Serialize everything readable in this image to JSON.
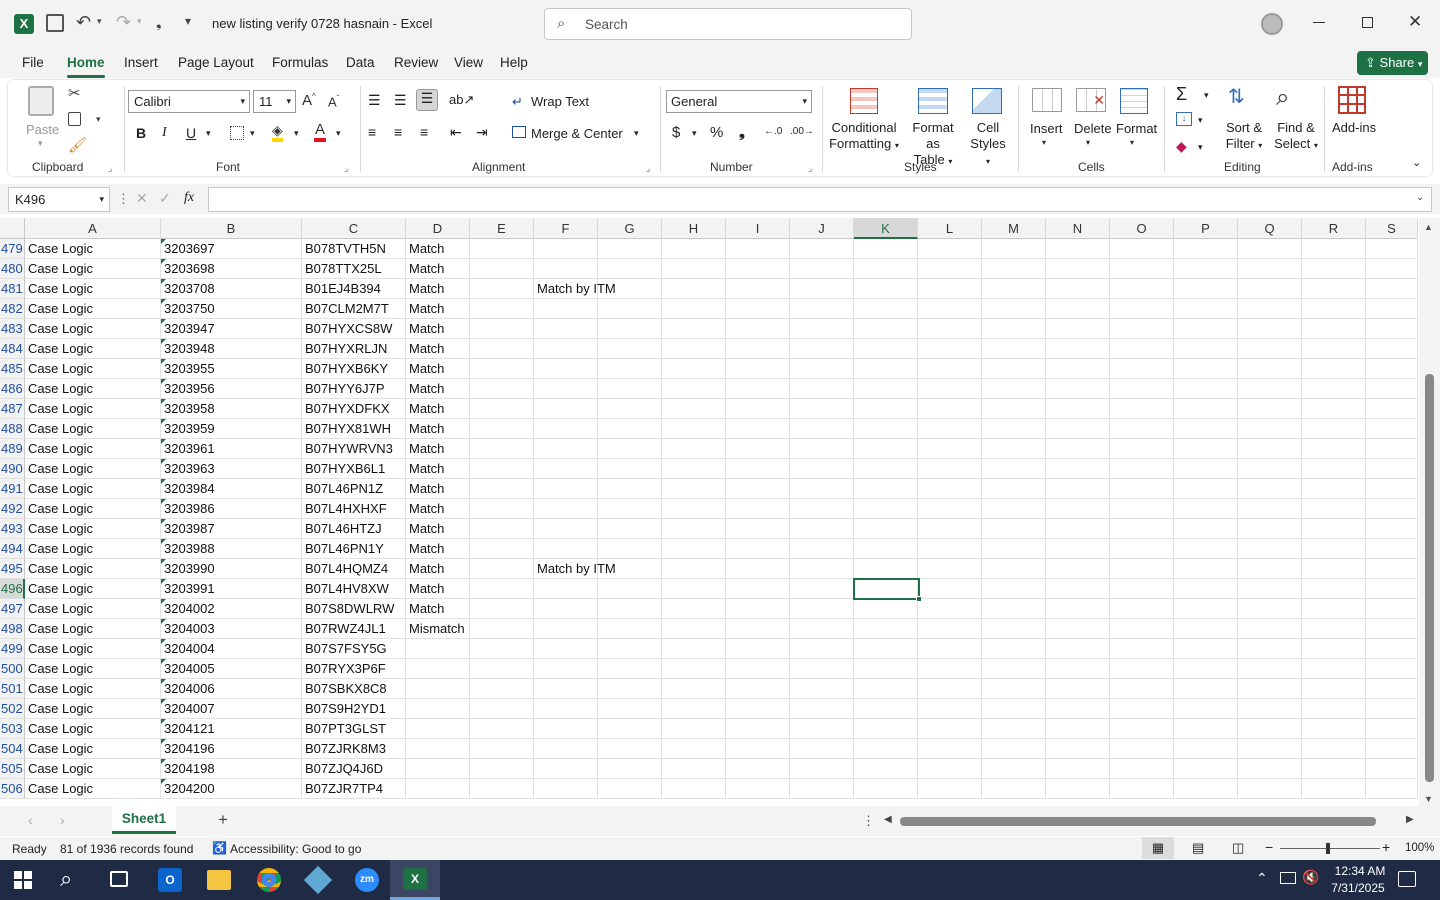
{
  "titlebar": {
    "doc_title": "new listing verify 0728 hasnain  -  Excel",
    "search_placeholder": "Search"
  },
  "menu": {
    "file": "File",
    "home": "Home",
    "insert": "Insert",
    "page_layout": "Page Layout",
    "formulas": "Formulas",
    "data": "Data",
    "review": "Review",
    "view": "View",
    "help": "Help",
    "share": "Share"
  },
  "ribbon": {
    "paste": "Paste",
    "clipboard": "Clipboard",
    "font_name": "Calibri",
    "font_size": "11",
    "font": "Font",
    "wrap_text": "Wrap Text",
    "merge_center": "Merge & Center",
    "alignment": "Alignment",
    "number_format": "General",
    "number": "Number",
    "cond_fmt_1": "Conditional",
    "cond_fmt_2": "Formatting",
    "fmt_table_1": "Format as",
    "fmt_table_2": "Table",
    "cell_styles_1": "Cell",
    "cell_styles_2": "Styles",
    "styles": "Styles",
    "insert": "Insert",
    "delete": "Delete",
    "format": "Format",
    "cells": "Cells",
    "sort_1": "Sort &",
    "sort_2": "Filter",
    "find_1": "Find &",
    "find_2": "Select",
    "editing": "Editing",
    "addins": "Add-ins",
    "addins_group": "Add-ins"
  },
  "formula_bar": {
    "name_box": "K496",
    "fx": "fx",
    "formula": ""
  },
  "columns": [
    "A",
    "B",
    "C",
    "D",
    "E",
    "F",
    "G",
    "H",
    "I",
    "J",
    "K",
    "L",
    "M",
    "N",
    "O",
    "P",
    "Q",
    "R",
    "S"
  ],
  "rows": [
    {
      "n": "479",
      "a": "Case Logic",
      "b": "3203697",
      "c": "B078TVTH5N",
      "d": "Match",
      "f": ""
    },
    {
      "n": "480",
      "a": "Case Logic",
      "b": "3203698",
      "c": "B078TTX25L",
      "d": "Match",
      "f": ""
    },
    {
      "n": "481",
      "a": "Case Logic",
      "b": "3203708",
      "c": "B01EJ4B394",
      "d": "Match",
      "f": "Match by ITM"
    },
    {
      "n": "482",
      "a": "Case Logic",
      "b": "3203750",
      "c": "B07CLM2M7T",
      "d": "Match",
      "f": ""
    },
    {
      "n": "483",
      "a": "Case Logic",
      "b": "3203947",
      "c": "B07HYXCS8W",
      "d": "Match",
      "f": ""
    },
    {
      "n": "484",
      "a": "Case Logic",
      "b": "3203948",
      "c": "B07HYXRLJN",
      "d": "Match",
      "f": ""
    },
    {
      "n": "485",
      "a": "Case Logic",
      "b": "3203955",
      "c": "B07HYXB6KY",
      "d": "Match",
      "f": ""
    },
    {
      "n": "486",
      "a": "Case Logic",
      "b": "3203956",
      "c": "B07HYY6J7P",
      "d": "Match",
      "f": ""
    },
    {
      "n": "487",
      "a": "Case Logic",
      "b": "3203958",
      "c": "B07HYXDFKX",
      "d": "Match",
      "f": ""
    },
    {
      "n": "488",
      "a": "Case Logic",
      "b": "3203959",
      "c": "B07HYX81WH",
      "d": "Match",
      "f": ""
    },
    {
      "n": "489",
      "a": "Case Logic",
      "b": "3203961",
      "c": "B07HYWRVN3",
      "d": "Match",
      "f": ""
    },
    {
      "n": "490",
      "a": "Case Logic",
      "b": "3203963",
      "c": "B07HYXB6L1",
      "d": "Match",
      "f": ""
    },
    {
      "n": "491",
      "a": "Case Logic",
      "b": "3203984",
      "c": "B07L46PN1Z",
      "d": "Match",
      "f": ""
    },
    {
      "n": "492",
      "a": "Case Logic",
      "b": "3203986",
      "c": "B07L4HXHXF",
      "d": "Match",
      "f": ""
    },
    {
      "n": "493",
      "a": "Case Logic",
      "b": "3203987",
      "c": "B07L46HTZJ",
      "d": "Match",
      "f": ""
    },
    {
      "n": "494",
      "a": "Case Logic",
      "b": "3203988",
      "c": "B07L46PN1Y",
      "d": "Match",
      "f": ""
    },
    {
      "n": "495",
      "a": "Case Logic",
      "b": "3203990",
      "c": "B07L4HQMZ4",
      "d": "Match",
      "f": "Match by ITM"
    },
    {
      "n": "496",
      "a": "Case Logic",
      "b": "3203991",
      "c": "B07L4HV8XW",
      "d": "Match",
      "f": ""
    },
    {
      "n": "497",
      "a": "Case Logic",
      "b": "3204002",
      "c": "B07S8DWLRW",
      "d": "Match",
      "f": ""
    },
    {
      "n": "498",
      "a": "Case Logic",
      "b": "3204003",
      "c": "B07RWZ4JL1",
      "d": "Mismatch",
      "f": ""
    },
    {
      "n": "499",
      "a": "Case Logic",
      "b": "3204004",
      "c": "B07S7FSY5G",
      "d": "",
      "f": ""
    },
    {
      "n": "500",
      "a": "Case Logic",
      "b": "3204005",
      "c": "B07RYX3P6F",
      "d": "",
      "f": ""
    },
    {
      "n": "501",
      "a": "Case Logic",
      "b": "3204006",
      "c": "B07SBKX8C8",
      "d": "",
      "f": ""
    },
    {
      "n": "502",
      "a": "Case Logic",
      "b": "3204007",
      "c": "B07S9H2YD1",
      "d": "",
      "f": ""
    },
    {
      "n": "503",
      "a": "Case Logic",
      "b": "3204121",
      "c": "B07PT3GLST",
      "d": "",
      "f": ""
    },
    {
      "n": "504",
      "a": "Case Logic",
      "b": "3204196",
      "c": "B07ZJRK8M3",
      "d": "",
      "f": ""
    },
    {
      "n": "505",
      "a": "Case Logic",
      "b": "3204198",
      "c": "B07ZJQ4J6D",
      "d": "",
      "f": ""
    },
    {
      "n": "506",
      "a": "Case Logic",
      "b": "3204200",
      "c": "B07ZJR7TP4",
      "d": "",
      "f": ""
    }
  ],
  "sheet": {
    "name": "Sheet1"
  },
  "status": {
    "ready": "Ready",
    "records": "81 of 1936 records found",
    "accessibility": "Accessibility: Good to go",
    "zoom": "100%"
  },
  "taskbar": {
    "time": "12:34 AM",
    "date": "7/31/2025"
  },
  "colors": {
    "excel_green": "#1e7145",
    "accent": "#217346",
    "taskbar": "#1f2a44"
  }
}
